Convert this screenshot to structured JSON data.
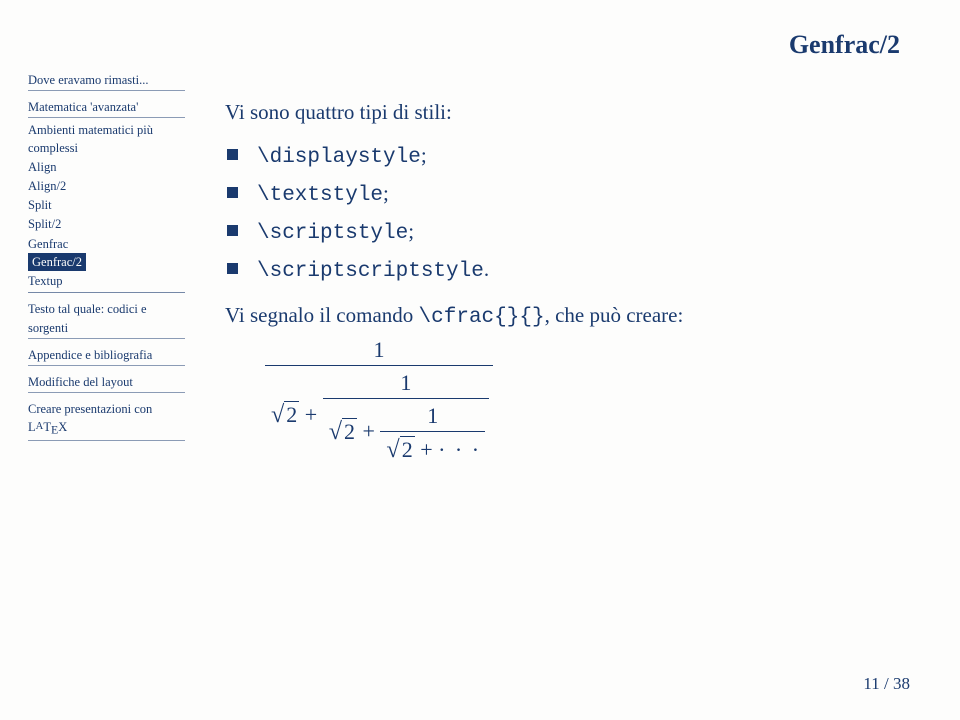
{
  "title": "Genfrac/2",
  "sidebar": {
    "group1": {
      "item0": "Dove eravamo rimasti..."
    },
    "group2": {
      "parent": "Matematica 'avanzata'",
      "items": [
        "Ambienti matematici più complessi",
        "Align",
        "Align/2",
        "Split",
        "Split/2",
        "Genfrac",
        "Genfrac/2",
        "Textup"
      ]
    },
    "group3": {
      "item0": "Testo tal quale: codici e sorgenti"
    },
    "group4": {
      "item0": "Appendice e bibliografia"
    },
    "group5": {
      "item0": "Modifiche del layout"
    },
    "group6": {
      "prefix": "Creare presentazioni con L",
      "a": "A",
      "t": "T",
      "e": "E",
      "x": "X"
    }
  },
  "content": {
    "intro": "Vi sono quattro tipi di stili:",
    "bullets": [
      {
        "code": "\\displaystyle",
        "suffix": ";"
      },
      {
        "code": "\\textstyle",
        "suffix": ";"
      },
      {
        "code": "\\scriptstyle",
        "suffix": ";"
      },
      {
        "code": "\\scriptscriptstyle",
        "suffix": "."
      }
    ],
    "para_pre": "Vi segnalo il comando ",
    "para_code": "\\cfrac{}{}",
    "para_post": ", che può creare:",
    "formula": {
      "n1": "1",
      "r1": "2",
      "p1": " + ",
      "n2": "1",
      "r2": "2",
      "p2": " + ",
      "n3": "1",
      "r3": "2",
      "p3": " + ",
      "dots": "· · ·"
    }
  },
  "pagenum": "11 / 38"
}
